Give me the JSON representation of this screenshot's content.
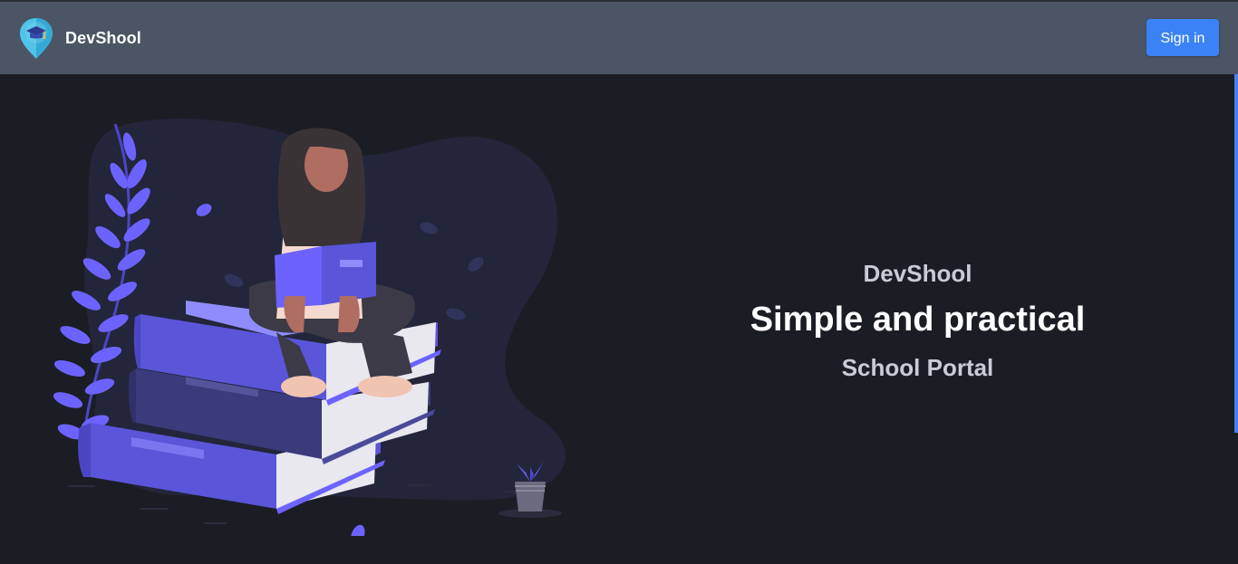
{
  "navbar": {
    "brand_name": "DevShool",
    "logo_icon": "graduation-cap-map-pin-icon",
    "signin_label": "Sign in"
  },
  "hero": {
    "brand": "DevShool",
    "headline": "Simple and practical",
    "subtitle": "School Portal",
    "illustration": "woman-reading-on-book-stack"
  },
  "colors": {
    "navbar_bg": "#4b5565",
    "page_bg": "#1b1d24",
    "accent": "#3b82f6",
    "illustration_purple": "#6c63ff"
  }
}
